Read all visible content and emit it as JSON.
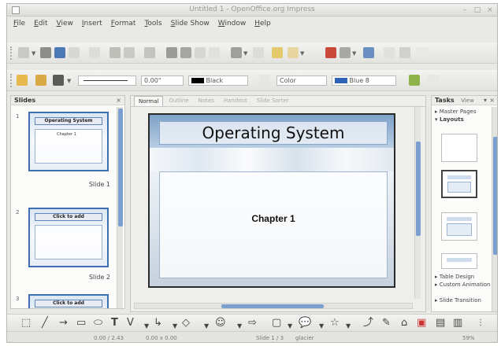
{
  "window": {
    "title": "Untitled 1 - OpenOffice.org Impress"
  },
  "menu": [
    "File",
    "Edit",
    "View",
    "Insert",
    "Format",
    "Tools",
    "Slide Show",
    "Window",
    "Help"
  ],
  "toolbar2": {
    "line_width": "0.00\"",
    "color_name": "Black",
    "line_style": "Color",
    "fill_name": "Blue 8",
    "colors": {
      "line_color": "#000000",
      "fill_color": "#2d62b5",
      "accent": "#3e6fb0"
    }
  },
  "slides_pane": {
    "title": "Slides",
    "slides": [
      {
        "number": "1",
        "label": "Slide 1",
        "title": "Operating System",
        "text": "Chapter 1"
      },
      {
        "number": "2",
        "label": "Slide 2",
        "title": "Click to add",
        "text": ""
      },
      {
        "number": "3",
        "label": "",
        "title": "Click to add",
        "text": ""
      }
    ]
  },
  "view_tabs": [
    "Normal",
    "Outline",
    "Notes",
    "Handout",
    "Slide Sorter"
  ],
  "slide": {
    "title": "Operating System",
    "body": "Chapter 1"
  },
  "tasks_pane": {
    "title": "Tasks",
    "view_label": "View",
    "items": [
      "Master Pages",
      "Layouts"
    ],
    "bottom_items": [
      "Table Design",
      "Custom Animation",
      "Slide Transition"
    ]
  },
  "statusbar": {
    "position": "0.00 / 2.43",
    "size": "0.00 x 0.00",
    "slide": "Slide 1 / 3",
    "layout": "glacier",
    "zoom": "59%"
  }
}
